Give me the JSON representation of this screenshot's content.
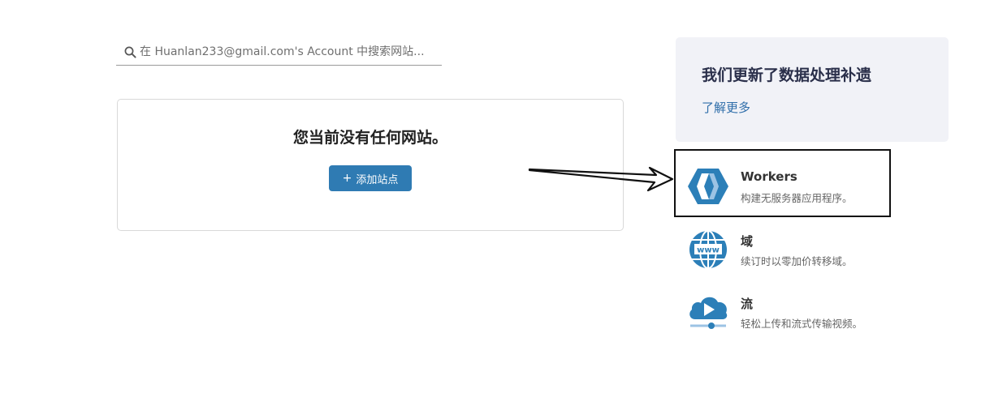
{
  "search": {
    "placeholder": "在 Huanlan233@gmail.com's Account 中搜索网站..."
  },
  "empty_state": {
    "title": "您当前没有任何网站。",
    "add_button_plus": "+",
    "add_button_label": "添加站点"
  },
  "notice": {
    "title": "我们更新了数据处理补遗",
    "link": "了解更多"
  },
  "products": [
    {
      "name": "Workers",
      "description": "构建无服务器应用程序。",
      "icon": "workers-icon"
    },
    {
      "name": "域",
      "description": "续订时以零加价转移域。",
      "icon": "www-globe-icon"
    },
    {
      "name": "流",
      "description": "轻松上传和流式传输视频。",
      "icon": "cloud-play-icon"
    }
  ],
  "icons": {
    "globe_text": "www"
  },
  "colors": {
    "primary": "#2f7bb3",
    "icon_blue": "#2c7fb8",
    "icon_light": "#9cc3e4",
    "notice_bg": "#f1f2f7",
    "link": "#2f6eaa"
  }
}
